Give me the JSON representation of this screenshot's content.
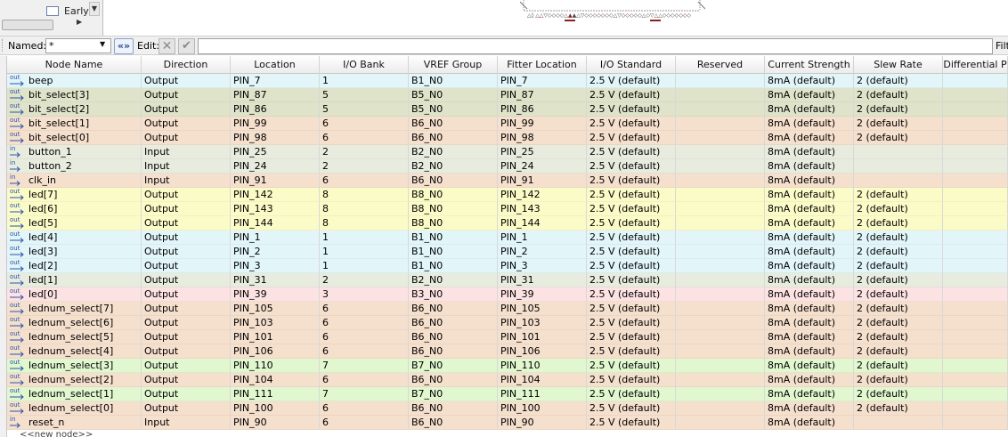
{
  "top_panel": {
    "checkbox_label": "Early"
  },
  "toolbar": {
    "named_label": "Named:",
    "named_value": "*",
    "edit_label": "Edit:",
    "edit_value": "",
    "filter_label": "Filt"
  },
  "colors": {
    "output_blue": "#e2f5f9",
    "output_olive": "#dee3c9",
    "output_peach": "#f5dfcd",
    "input_gray": "#e8ecdf",
    "output_yellow": "#fbfbc8",
    "output_pink": "#fce2e2",
    "output_green": "#e0f7cf",
    "icon_blue": "#2a56a8"
  },
  "table": {
    "columns": [
      "Node Name",
      "Direction",
      "Location",
      "I/O Bank",
      "VREF Group",
      "Fitter Location",
      "I/O Standard",
      "Reserved",
      "Current Strength",
      "Slew Rate",
      "Differential P"
    ],
    "rows": [
      {
        "dir_icon": "out",
        "name": "beep",
        "direction": "Output",
        "location": "PIN_7",
        "bank": "1",
        "vref": "B1_N0",
        "fitter": "PIN_7",
        "standard": "2.5 V (default)",
        "reserved": "",
        "strength": "8mA (default)",
        "slew": "2 (default)",
        "diff": "",
        "color": "#e2f5f9"
      },
      {
        "dir_icon": "out",
        "name": "bit_select[3]",
        "direction": "Output",
        "location": "PIN_87",
        "bank": "5",
        "vref": "B5_N0",
        "fitter": "PIN_87",
        "standard": "2.5 V (default)",
        "reserved": "",
        "strength": "8mA (default)",
        "slew": "2 (default)",
        "diff": "",
        "color": "#dee3c9"
      },
      {
        "dir_icon": "out",
        "name": "bit_select[2]",
        "direction": "Output",
        "location": "PIN_86",
        "bank": "5",
        "vref": "B5_N0",
        "fitter": "PIN_86",
        "standard": "2.5 V (default)",
        "reserved": "",
        "strength": "8mA (default)",
        "slew": "2 (default)",
        "diff": "",
        "color": "#dee3c9"
      },
      {
        "dir_icon": "out",
        "name": "bit_select[1]",
        "direction": "Output",
        "location": "PIN_99",
        "bank": "6",
        "vref": "B6_N0",
        "fitter": "PIN_99",
        "standard": "2.5 V (default)",
        "reserved": "",
        "strength": "8mA (default)",
        "slew": "2 (default)",
        "diff": "",
        "color": "#f5dfcd"
      },
      {
        "dir_icon": "out",
        "name": "bit_select[0]",
        "direction": "Output",
        "location": "PIN_98",
        "bank": "6",
        "vref": "B6_N0",
        "fitter": "PIN_98",
        "standard": "2.5 V (default)",
        "reserved": "",
        "strength": "8mA (default)",
        "slew": "2 (default)",
        "diff": "",
        "color": "#f5dfcd"
      },
      {
        "dir_icon": "in",
        "name": "button_1",
        "direction": "Input",
        "location": "PIN_25",
        "bank": "2",
        "vref": "B2_N0",
        "fitter": "PIN_25",
        "standard": "2.5 V (default)",
        "reserved": "",
        "strength": "8mA (default)",
        "slew": "",
        "diff": "",
        "color": "#e8ecdf"
      },
      {
        "dir_icon": "in",
        "name": "button_2",
        "direction": "Input",
        "location": "PIN_24",
        "bank": "2",
        "vref": "B2_N0",
        "fitter": "PIN_24",
        "standard": "2.5 V (default)",
        "reserved": "",
        "strength": "8mA (default)",
        "slew": "",
        "diff": "",
        "color": "#e8ecdf"
      },
      {
        "dir_icon": "in",
        "name": "clk_in",
        "direction": "Input",
        "location": "PIN_91",
        "bank": "6",
        "vref": "B6_N0",
        "fitter": "PIN_91",
        "standard": "2.5 V (default)",
        "reserved": "",
        "strength": "8mA (default)",
        "slew": "",
        "diff": "",
        "color": "#f5dfcd"
      },
      {
        "dir_icon": "out",
        "name": "led[7]",
        "direction": "Output",
        "location": "PIN_142",
        "bank": "8",
        "vref": "B8_N0",
        "fitter": "PIN_142",
        "standard": "2.5 V (default)",
        "reserved": "",
        "strength": "8mA (default)",
        "slew": "2 (default)",
        "diff": "",
        "color": "#fbfbc8"
      },
      {
        "dir_icon": "out",
        "name": "led[6]",
        "direction": "Output",
        "location": "PIN_143",
        "bank": "8",
        "vref": "B8_N0",
        "fitter": "PIN_143",
        "standard": "2.5 V (default)",
        "reserved": "",
        "strength": "8mA (default)",
        "slew": "2 (default)",
        "diff": "",
        "color": "#fbfbc8"
      },
      {
        "dir_icon": "out",
        "name": "led[5]",
        "direction": "Output",
        "location": "PIN_144",
        "bank": "8",
        "vref": "B8_N0",
        "fitter": "PIN_144",
        "standard": "2.5 V (default)",
        "reserved": "",
        "strength": "8mA (default)",
        "slew": "2 (default)",
        "diff": "",
        "color": "#fbfbc8"
      },
      {
        "dir_icon": "out",
        "name": "led[4]",
        "direction": "Output",
        "location": "PIN_1",
        "bank": "1",
        "vref": "B1_N0",
        "fitter": "PIN_1",
        "standard": "2.5 V (default)",
        "reserved": "",
        "strength": "8mA (default)",
        "slew": "2 (default)",
        "diff": "",
        "color": "#e2f5f9"
      },
      {
        "dir_icon": "out",
        "name": "led[3]",
        "direction": "Output",
        "location": "PIN_2",
        "bank": "1",
        "vref": "B1_N0",
        "fitter": "PIN_2",
        "standard": "2.5 V (default)",
        "reserved": "",
        "strength": "8mA (default)",
        "slew": "2 (default)",
        "diff": "",
        "color": "#e2f5f9"
      },
      {
        "dir_icon": "out",
        "name": "led[2]",
        "direction": "Output",
        "location": "PIN_3",
        "bank": "1",
        "vref": "B1_N0",
        "fitter": "PIN_3",
        "standard": "2.5 V (default)",
        "reserved": "",
        "strength": "8mA (default)",
        "slew": "2 (default)",
        "diff": "",
        "color": "#e2f5f9"
      },
      {
        "dir_icon": "out",
        "name": "led[1]",
        "direction": "Output",
        "location": "PIN_31",
        "bank": "2",
        "vref": "B2_N0",
        "fitter": "PIN_31",
        "standard": "2.5 V (default)",
        "reserved": "",
        "strength": "8mA (default)",
        "slew": "2 (default)",
        "diff": "",
        "color": "#e8ecdf"
      },
      {
        "dir_icon": "out",
        "name": "led[0]",
        "direction": "Output",
        "location": "PIN_39",
        "bank": "3",
        "vref": "B3_N0",
        "fitter": "PIN_39",
        "standard": "2.5 V (default)",
        "reserved": "",
        "strength": "8mA (default)",
        "slew": "2 (default)",
        "diff": "",
        "color": "#fce2e2"
      },
      {
        "dir_icon": "out",
        "name": "lednum_select[7]",
        "direction": "Output",
        "location": "PIN_105",
        "bank": "6",
        "vref": "B6_N0",
        "fitter": "PIN_105",
        "standard": "2.5 V (default)",
        "reserved": "",
        "strength": "8mA (default)",
        "slew": "2 (default)",
        "diff": "",
        "color": "#f5dfcd"
      },
      {
        "dir_icon": "out",
        "name": "lednum_select[6]",
        "direction": "Output",
        "location": "PIN_103",
        "bank": "6",
        "vref": "B6_N0",
        "fitter": "PIN_103",
        "standard": "2.5 V (default)",
        "reserved": "",
        "strength": "8mA (default)",
        "slew": "2 (default)",
        "diff": "",
        "color": "#f5dfcd"
      },
      {
        "dir_icon": "out",
        "name": "lednum_select[5]",
        "direction": "Output",
        "location": "PIN_101",
        "bank": "6",
        "vref": "B6_N0",
        "fitter": "PIN_101",
        "standard": "2.5 V (default)",
        "reserved": "",
        "strength": "8mA (default)",
        "slew": "2 (default)",
        "diff": "",
        "color": "#f5dfcd"
      },
      {
        "dir_icon": "out",
        "name": "lednum_select[4]",
        "direction": "Output",
        "location": "PIN_106",
        "bank": "6",
        "vref": "B6_N0",
        "fitter": "PIN_106",
        "standard": "2.5 V (default)",
        "reserved": "",
        "strength": "8mA (default)",
        "slew": "2 (default)",
        "diff": "",
        "color": "#f5dfcd"
      },
      {
        "dir_icon": "out",
        "name": "lednum_select[3]",
        "direction": "Output",
        "location": "PIN_110",
        "bank": "7",
        "vref": "B7_N0",
        "fitter": "PIN_110",
        "standard": "2.5 V (default)",
        "reserved": "",
        "strength": "8mA (default)",
        "slew": "2 (default)",
        "diff": "",
        "color": "#e0f7cf"
      },
      {
        "dir_icon": "out",
        "name": "lednum_select[2]",
        "direction": "Output",
        "location": "PIN_104",
        "bank": "6",
        "vref": "B6_N0",
        "fitter": "PIN_104",
        "standard": "2.5 V (default)",
        "reserved": "",
        "strength": "8mA (default)",
        "slew": "2 (default)",
        "diff": "",
        "color": "#f5dfcd"
      },
      {
        "dir_icon": "out",
        "name": "lednum_select[1]",
        "direction": "Output",
        "location": "PIN_111",
        "bank": "7",
        "vref": "B7_N0",
        "fitter": "PIN_111",
        "standard": "2.5 V (default)",
        "reserved": "",
        "strength": "8mA (default)",
        "slew": "2 (default)",
        "diff": "",
        "color": "#e0f7cf"
      },
      {
        "dir_icon": "out",
        "name": "lednum_select[0]",
        "direction": "Output",
        "location": "PIN_100",
        "bank": "6",
        "vref": "B6_N0",
        "fitter": "PIN_100",
        "standard": "2.5 V (default)",
        "reserved": "",
        "strength": "8mA (default)",
        "slew": "2 (default)",
        "diff": "",
        "color": "#f5dfcd"
      },
      {
        "dir_icon": "in",
        "name": "reset_n",
        "direction": "Input",
        "location": "PIN_90",
        "bank": "6",
        "vref": "B6_N0",
        "fitter": "PIN_90",
        "standard": "2.5 V (default)",
        "reserved": "",
        "strength": "8mA (default)",
        "slew": "",
        "diff": "",
        "color": "#f5dfcd"
      }
    ],
    "new_node_label": "<<new node>>"
  }
}
